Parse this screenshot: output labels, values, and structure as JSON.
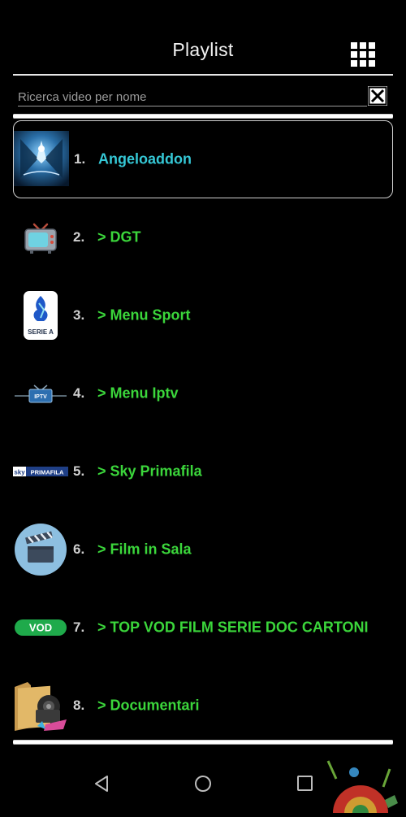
{
  "header": {
    "title": "Playlist",
    "grid_icon": "grid-menu-icon"
  },
  "search": {
    "placeholder": "Ricerca video per nome",
    "value": "",
    "clear_icon": "close-box-icon"
  },
  "playlist": [
    {
      "number": "1.",
      "label": "Angeloaddon",
      "icon": "angeloaddon-thumbnail",
      "selected": true
    },
    {
      "number": "2.",
      "label": "> DGT",
      "icon": "tv-icon"
    },
    {
      "number": "3.",
      "label": "> Menu Sport",
      "icon": "serie-a-logo"
    },
    {
      "number": "4.",
      "label": "> Menu Iptv",
      "icon": "iptv-logo"
    },
    {
      "number": "5.",
      "label": "> Sky Primafila",
      "icon": "sky-primafila-logo"
    },
    {
      "number": "6.",
      "label": "> Film in Sala",
      "icon": "clapperboard-icon"
    },
    {
      "number": "7.",
      "label": "> TOP VOD FILM SERIE DOC CARTONI",
      "icon": "vod-badge"
    },
    {
      "number": "8.",
      "label": "> Documentari",
      "icon": "documentary-folder-icon"
    }
  ],
  "thumb_text": {
    "serie_a": "SERIE A",
    "vod": "VOD",
    "sky": "sky",
    "primafila": "PRIMAFILA"
  },
  "navbar": {
    "back_icon": "back-triangle-icon",
    "home_icon": "home-circle-icon",
    "recents_icon": "recents-square-icon"
  },
  "colors": {
    "background": "#000000",
    "label_green": "#3bd63b",
    "label_cyan": "#35c8d6",
    "number_gray": "#cfcfcf"
  }
}
